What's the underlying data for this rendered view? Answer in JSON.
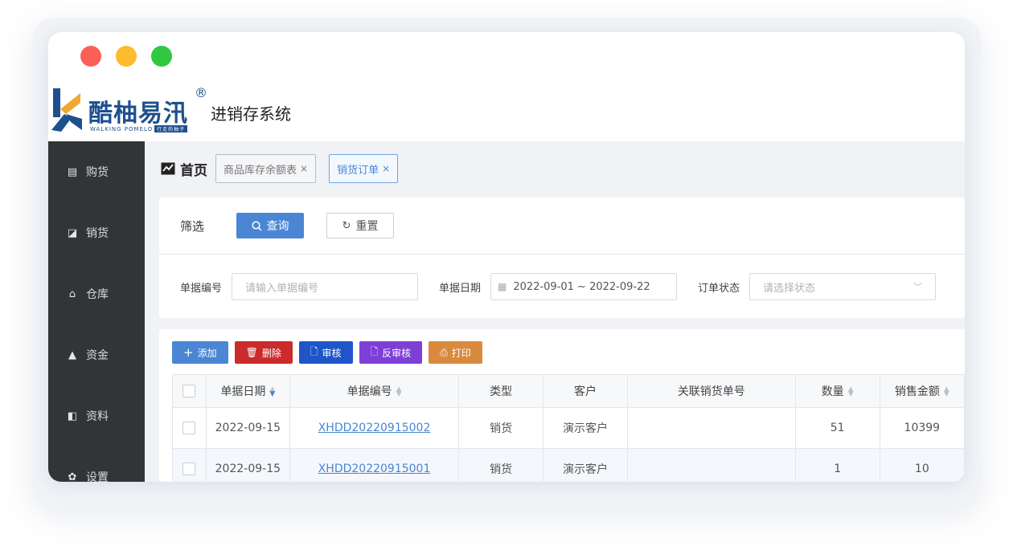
{
  "brand": {
    "name_cn": "酷柚易汛",
    "reg_mark": "®",
    "name_en": "WALKING POMELO",
    "tagline": "行走的柚子",
    "system_title": "进销存系统",
    "colors": {
      "brand": "#1e4f8f",
      "accent": "#4a86d4"
    }
  },
  "sidebar": {
    "items": [
      {
        "label": "购货",
        "icon": "purchase-icon"
      },
      {
        "label": "销货",
        "icon": "sales-icon"
      },
      {
        "label": "仓库",
        "icon": "warehouse-icon"
      },
      {
        "label": "资金",
        "icon": "money-bag-icon"
      },
      {
        "label": "资料",
        "icon": "data-icon"
      },
      {
        "label": "设置",
        "icon": "gear-icon"
      }
    ]
  },
  "tabs": {
    "home": "首页",
    "items": [
      {
        "label": "商品库存余额表",
        "close": "×"
      },
      {
        "label": "销货订单",
        "close": "×",
        "active": true
      }
    ]
  },
  "filter": {
    "title": "筛选",
    "query_label": "查询",
    "reset_label": "重置",
    "doc_no_label": "单据编号",
    "doc_no_placeholder": "请输入单据编号",
    "date_label": "单据日期",
    "date_range": "2022-09-01 ~ 2022-09-22",
    "status_label": "订单状态",
    "status_placeholder": "请选择状态"
  },
  "toolbar": {
    "add": "添加",
    "delete": "删除",
    "audit": "审核",
    "unaudit": "反审核",
    "print": "打印"
  },
  "table": {
    "columns": [
      "单据日期",
      "单据编号",
      "类型",
      "客户",
      "关联销货单号",
      "数量",
      "销售金额"
    ],
    "rows": [
      {
        "date": "2022-09-15",
        "no": "XHDD20220915002",
        "type": "销货",
        "customer": "演示客户",
        "related": "",
        "qty": "51",
        "amount": "10399"
      },
      {
        "date": "2022-09-15",
        "no": "XHDD20220915001",
        "type": "销货",
        "customer": "演示客户",
        "related": "",
        "qty": "1",
        "amount": "10"
      }
    ]
  }
}
